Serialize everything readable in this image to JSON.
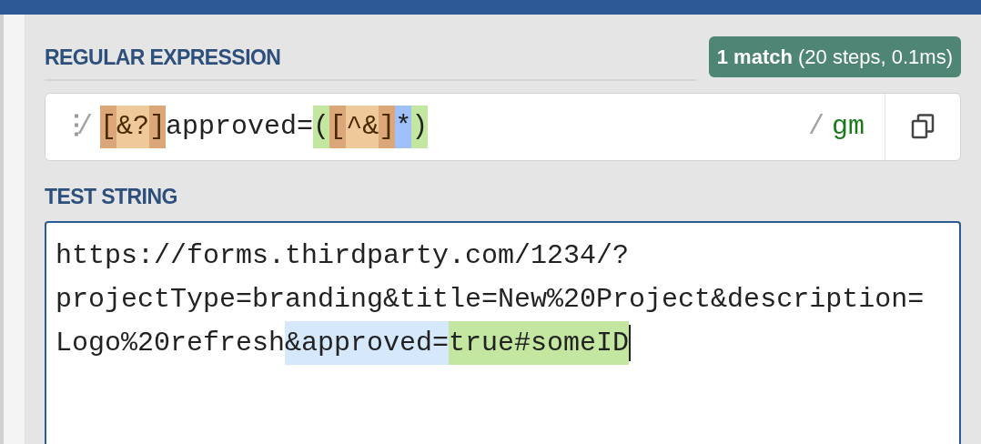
{
  "regex_section": {
    "heading": "REGULAR EXPRESSION",
    "match_badge": "**1 match** (20 steps, 0.1ms)",
    "field": {
      "menu_glyph": "⋮",
      "open_delimiter": "/",
      "close_delimiter": "/",
      "flags": "gm",
      "tokens": [
        {
          "text": "[",
          "kind": "set-bracket"
        },
        {
          "text": "&?",
          "kind": "set-content"
        },
        {
          "text": "]",
          "kind": "set-bracket"
        },
        {
          "text": "approved=",
          "kind": "literal"
        },
        {
          "text": "(",
          "kind": "group"
        },
        {
          "text": "[",
          "kind": "set-bracket"
        },
        {
          "text": "^&",
          "kind": "set-content"
        },
        {
          "text": "]",
          "kind": "set-bracket"
        },
        {
          "text": "*",
          "kind": "quantifier"
        },
        {
          "text": ")",
          "kind": "group"
        }
      ]
    }
  },
  "test_section": {
    "heading": "TEST STRING",
    "lines": [
      [
        {
          "text": "https://forms.thirdparty.com/1234/?",
          "kind": "plain"
        }
      ],
      [
        {
          "text": "projectType=branding&title=New%20Project&description=",
          "kind": "plain"
        }
      ],
      [
        {
          "text": "Logo%20refresh",
          "kind": "plain"
        },
        {
          "text": "&approved=",
          "kind": "match"
        },
        {
          "text": "true#someID",
          "kind": "group"
        }
      ]
    ]
  }
}
